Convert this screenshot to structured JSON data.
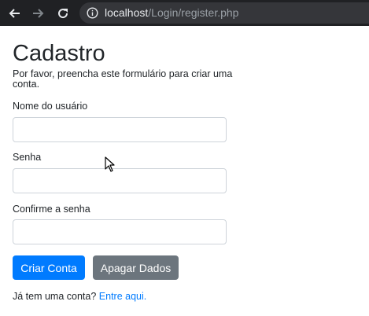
{
  "browser": {
    "url_host": "localhost",
    "url_path": "/Login/register.php",
    "icons": [
      "back-arrow-icon",
      "forward-arrow-icon",
      "reload-icon",
      "info-icon"
    ]
  },
  "form": {
    "title": "Cadastro",
    "intro": "Por favor, preencha este formulário para criar uma conta.",
    "username_label": "Nome do usuário",
    "username_value": "",
    "password_label": "Senha",
    "password_value": "",
    "confirm_label": "Confirme a senha",
    "confirm_value": "",
    "submit_label": "Criar Conta",
    "reset_label": "Apagar Dados",
    "footer_text": "Já tem uma conta?",
    "footer_link": "Entre aqui."
  },
  "colors": {
    "primary": "#007bff",
    "secondary": "#6c757d",
    "browser_bg": "#202124"
  }
}
